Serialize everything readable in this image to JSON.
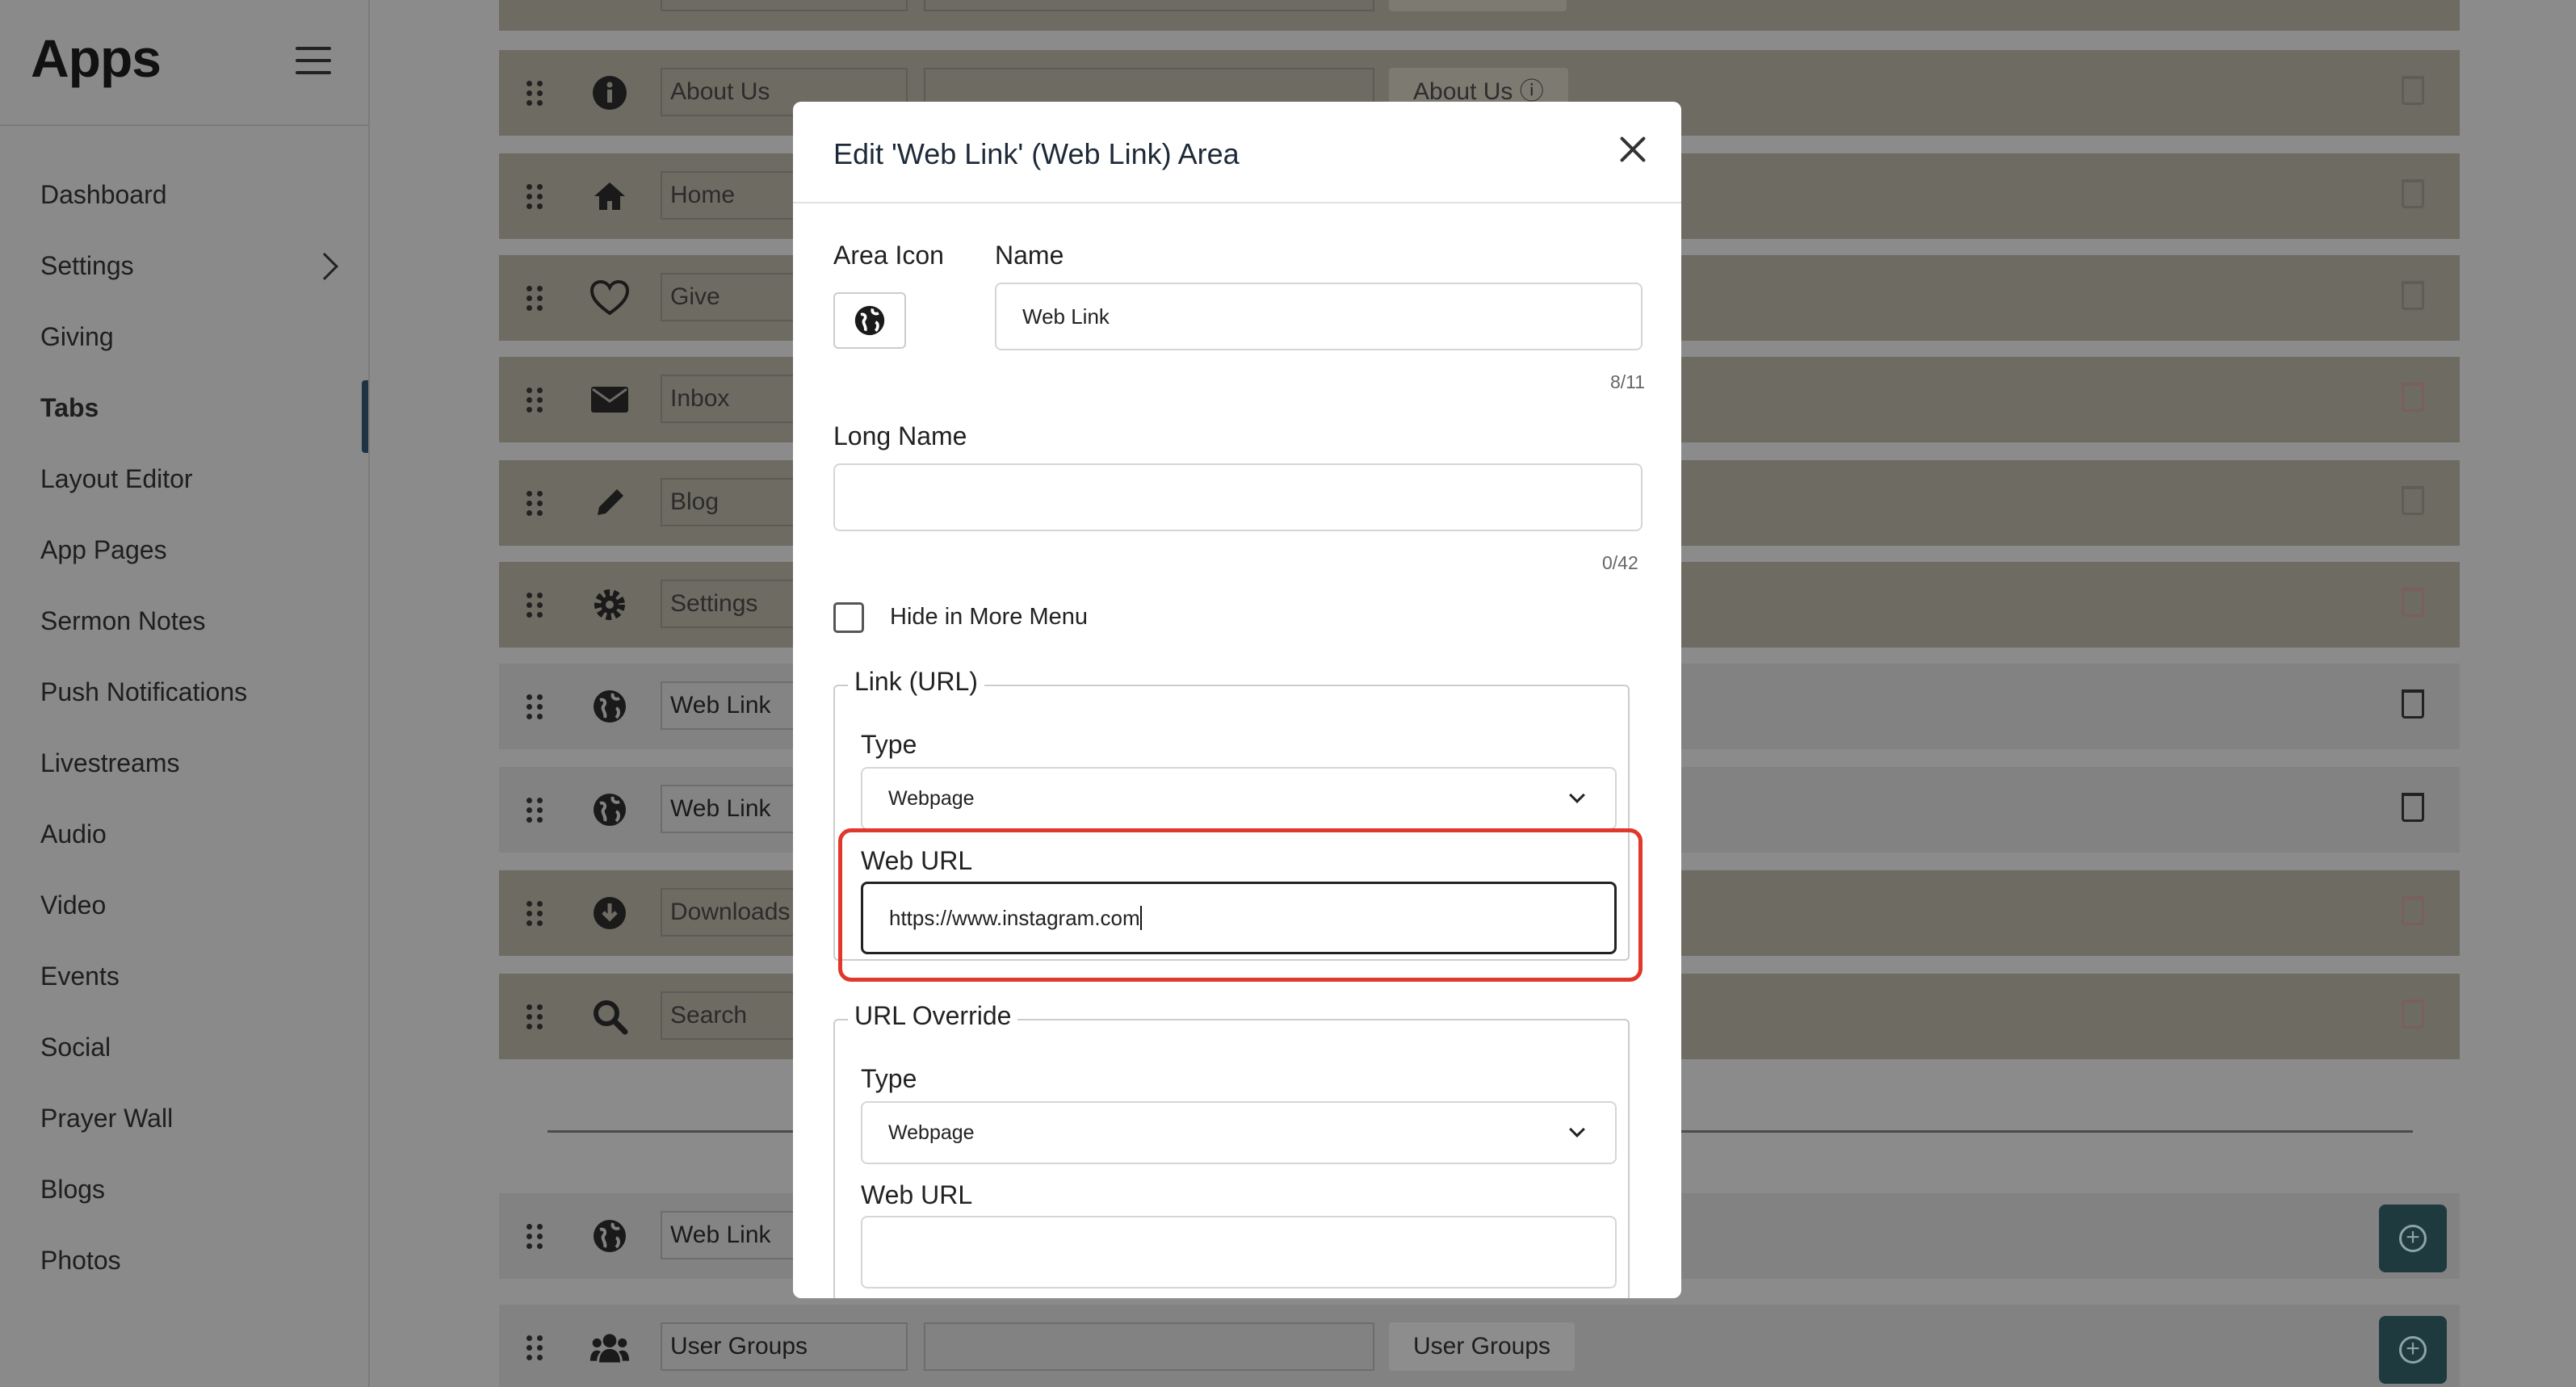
{
  "sidebar": {
    "title": "Apps",
    "items": [
      {
        "label": "Dashboard"
      },
      {
        "label": "Settings"
      },
      {
        "label": "Giving"
      },
      {
        "label": "Tabs"
      },
      {
        "label": "Layout Editor"
      },
      {
        "label": "App Pages"
      },
      {
        "label": "Sermon Notes"
      },
      {
        "label": "Push Notifications"
      },
      {
        "label": "Livestreams"
      },
      {
        "label": "Audio"
      },
      {
        "label": "Video"
      },
      {
        "label": "Events"
      },
      {
        "label": "Social"
      },
      {
        "label": "Prayer Wall"
      },
      {
        "label": "Blogs"
      },
      {
        "label": "Photos"
      }
    ]
  },
  "rows": [
    {
      "name": "About Us",
      "badge": "About Us ⓘ"
    },
    {
      "name": "Home"
    },
    {
      "name": "Give"
    },
    {
      "name": "Inbox"
    },
    {
      "name": "Blog"
    },
    {
      "name": "Settings"
    },
    {
      "name": "Web Link"
    },
    {
      "name": "Web Link"
    },
    {
      "name": "Downloads"
    },
    {
      "name": "Search"
    }
  ],
  "extra_rows": [
    {
      "name": "Web Link"
    },
    {
      "name": "User Groups",
      "badge": "User Groups"
    }
  ],
  "modal": {
    "title": "Edit 'Web Link' (Web Link) Area",
    "area_icon_label": "Area Icon",
    "name_label": "Name",
    "name_value": "Web Link",
    "name_counter": "8/11",
    "long_name_label": "Long Name",
    "long_name_value": "",
    "long_name_counter": "0/42",
    "hide_label": "Hide in More Menu",
    "link_section": {
      "legend": "Link (URL)",
      "type_label": "Type",
      "type_value": "Webpage",
      "url_label": "Web URL",
      "url_value": "https://www.instagram.com"
    },
    "override_section": {
      "legend": "URL Override",
      "type_label": "Type",
      "type_value": "Webpage",
      "url_label": "Web URL",
      "url_value": ""
    }
  },
  "colors": {
    "accent": "#1e3444",
    "highlight": "#e0382a",
    "add_button": "#1f3a3f"
  }
}
